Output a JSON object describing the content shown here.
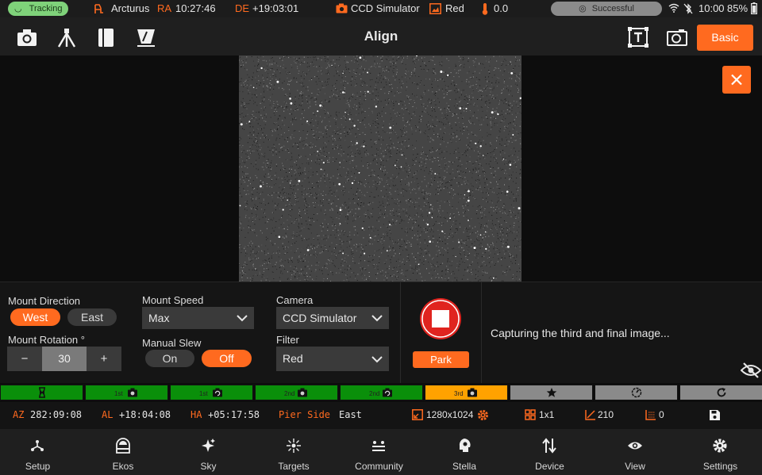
{
  "status_bar": {
    "tracking": "Tracking",
    "target": "Arcturus",
    "ra_label": "RA",
    "ra_value": "10:27:46",
    "de_label": "DE",
    "de_value": "+19:03:01",
    "camera": "CCD Simulator",
    "filter": "Red",
    "temperature": "0.0",
    "guide_status": "Successful",
    "time": "10:00",
    "battery": "85%"
  },
  "toolbar": {
    "title": "Align",
    "mode_button": "Basic"
  },
  "controls": {
    "mount_direction_label": "Mount Direction",
    "west": "West",
    "east": "East",
    "mount_rotation_label": "Mount Rotation °",
    "decrement": "−",
    "rotation_value": "30",
    "increment": "+",
    "mount_speed_label": "Mount Speed",
    "mount_speed_value": "Max",
    "manual_slew_label": "Manual Slew",
    "slew_on": "On",
    "slew_off": "Off",
    "camera_label": "Camera",
    "camera_value": "CCD Simulator",
    "filter_label": "Filter",
    "filter_value": "Red",
    "park_button": "Park",
    "status_message": "Capturing the third and final image..."
  },
  "progress_steps": [
    {
      "label": "",
      "icon": "hourglass-icon",
      "color": "#0a8f0a"
    },
    {
      "label": "1st",
      "icon": "camera-icon",
      "color": "#0a8f0a"
    },
    {
      "label": "1st",
      "icon": "solve-icon",
      "color": "#0a8f0a"
    },
    {
      "label": "2nd",
      "icon": "camera-icon",
      "color": "#0a8f0a"
    },
    {
      "label": "2nd",
      "icon": "solve-icon",
      "color": "#0a8f0a"
    },
    {
      "label": "3rd",
      "icon": "camera-icon",
      "color": "#ffa200"
    },
    {
      "label": "",
      "icon": "star-icon",
      "color": "#8a8a8a"
    },
    {
      "label": "",
      "icon": "compass-icon",
      "color": "#8a8a8a"
    },
    {
      "label": "",
      "icon": "refresh-icon",
      "color": "#8a8a8a"
    }
  ],
  "coords": {
    "az_label": "AZ",
    "az_value": "282:09:08",
    "al_label": "AL",
    "al_value": "+18:04:08",
    "ha_label": "HA",
    "ha_value": "+05:17:58",
    "pier_label": "Pier Side",
    "pier_value": "East",
    "resolution": "1280x1024",
    "binning": "1x1",
    "exposure_count": "210",
    "offset": "0"
  },
  "bottom_nav": [
    {
      "label": "Setup",
      "icon": "setup-icon"
    },
    {
      "label": "Ekos",
      "icon": "ekos-icon"
    },
    {
      "label": "Sky",
      "icon": "sky-icon"
    },
    {
      "label": "Targets",
      "icon": "targets-icon"
    },
    {
      "label": "Community",
      "icon": "community-icon"
    },
    {
      "label": "Stella",
      "icon": "stella-icon"
    },
    {
      "label": "Device",
      "icon": "device-icon"
    },
    {
      "label": "View",
      "icon": "view-icon"
    },
    {
      "label": "Settings",
      "icon": "settings-icon"
    }
  ],
  "colors": {
    "accent": "#ff6a1f",
    "tracking_green": "#7fd27a",
    "step_done": "#0a8f0a",
    "step_active": "#ffa200",
    "step_pending": "#8a8a8a"
  }
}
